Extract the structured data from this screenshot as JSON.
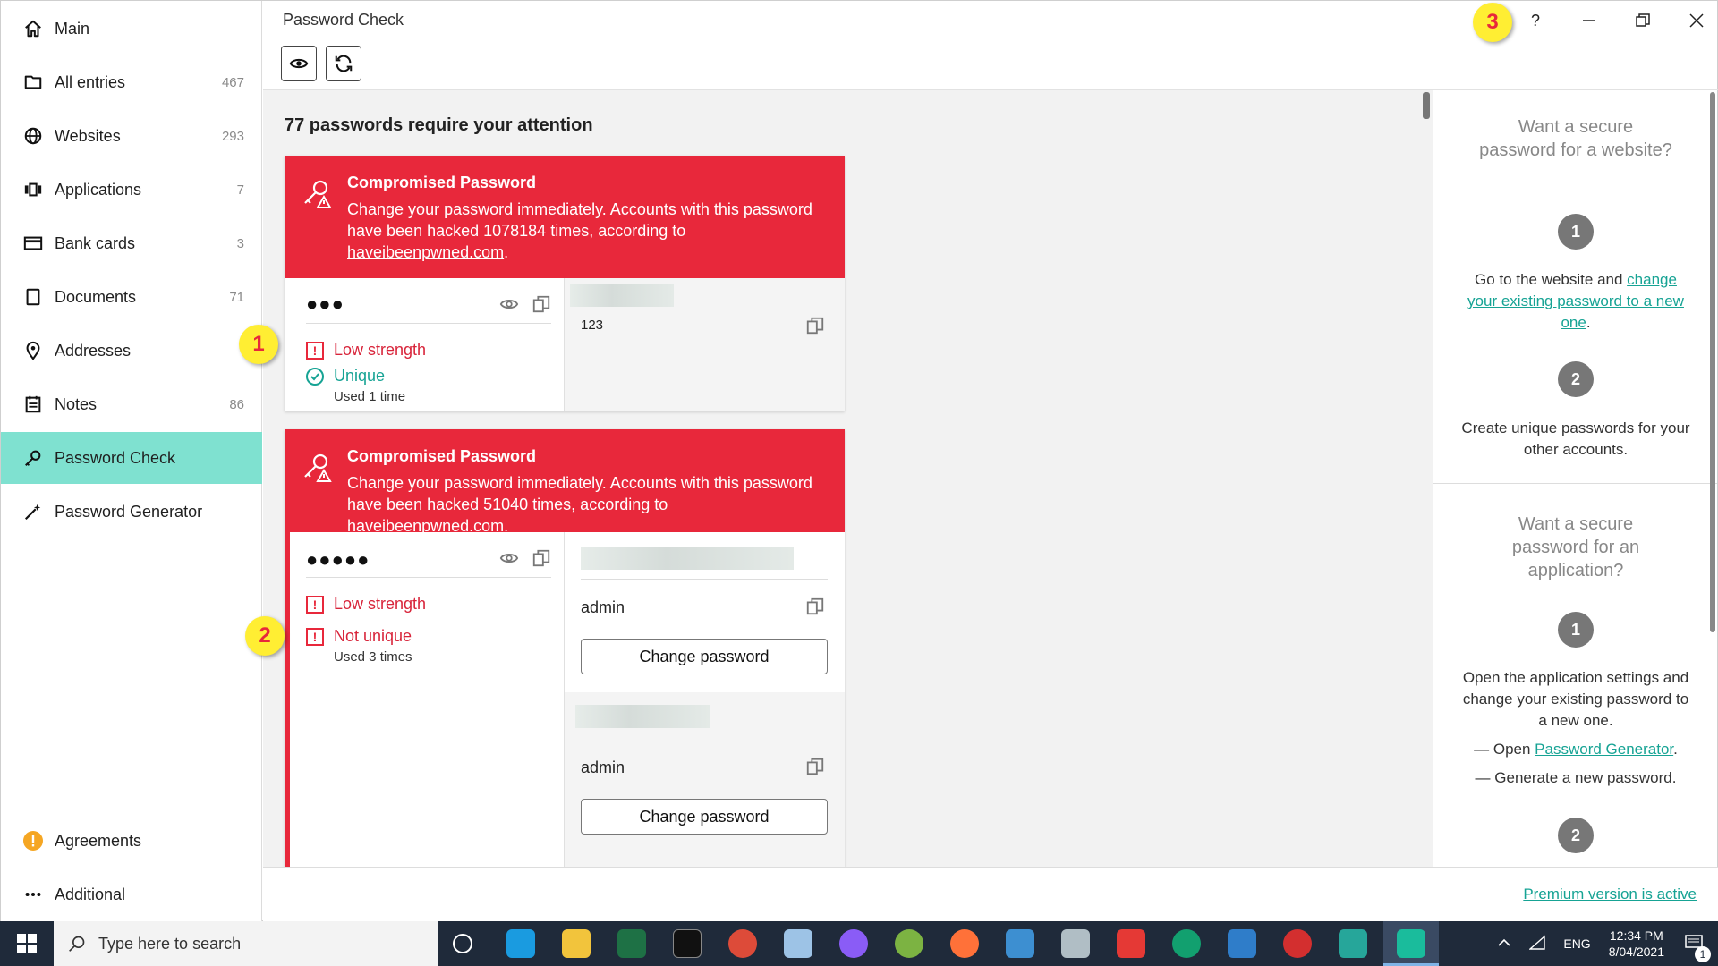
{
  "sidebar": {
    "items": [
      {
        "label": "Main",
        "count": "",
        "icon": "home-icon"
      },
      {
        "label": "All entries",
        "count": "467",
        "icon": "folder-icon"
      },
      {
        "label": "Websites",
        "count": "293",
        "icon": "globe-icon"
      },
      {
        "label": "Applications",
        "count": "7",
        "icon": "applications-icon"
      },
      {
        "label": "Bank cards",
        "count": "3",
        "icon": "card-icon"
      },
      {
        "label": "Documents",
        "count": "71",
        "icon": "document-icon"
      },
      {
        "label": "Addresses",
        "count": "",
        "icon": "pin-icon"
      },
      {
        "label": "Notes",
        "count": "86",
        "icon": "notes-icon"
      },
      {
        "label": "Password Check",
        "count": "",
        "icon": "key-icon"
      },
      {
        "label": "Password Generator",
        "count": "",
        "icon": "wand-icon"
      }
    ],
    "bottom": [
      {
        "label": "Agreements",
        "icon": "warning-icon"
      },
      {
        "label": "Additional",
        "icon": "more-icon"
      }
    ]
  },
  "window": {
    "title": "Password Check",
    "help": "?",
    "accent": "#7fe1d0",
    "danger": "#e8283b"
  },
  "main": {
    "heading": "77 passwords require your attention",
    "cards": [
      {
        "title": "Compromised Password",
        "body_prefix": "Change your password immediately. Accounts with this password have been hacked 1078184 times, according to ",
        "link": "haveibeenpwned.com",
        "body_suffix": ".",
        "masked": "●●●",
        "status1": "Low strength",
        "status2": "Unique",
        "used": "Used 1 time",
        "accounts": [
          {
            "name": "123"
          }
        ]
      },
      {
        "title": "Compromised Password",
        "body_prefix": "Change your password immediately. Accounts with this password have been hacked 51040 times, according to ",
        "link": "haveibeenpwned.com",
        "body_suffix": ".",
        "masked": "●●●●●",
        "status1": "Low strength",
        "status2": "Not unique",
        "used": "Used 3 times",
        "accounts": [
          {
            "name": "admin",
            "button": "Change password"
          },
          {
            "name": "admin",
            "button": "Change password"
          }
        ]
      }
    ]
  },
  "help": {
    "website": {
      "question": "Want a secure password for a website?",
      "step1_num": "1",
      "step1_prefix": "Go to the website and ",
      "step1_link": "change your existing password to a new one",
      "step1_suffix": ".",
      "step2_num": "2",
      "step2": "Create unique passwords for your other accounts."
    },
    "application": {
      "question": "Want a secure password for an application?",
      "step1_num": "1",
      "step1": "Open the application settings and change your existing password to a new one.",
      "bullet1_prefix": "— Open ",
      "bullet1_link": "Password Generator",
      "bullet1_suffix": ".",
      "bullet2": "— Generate a new password.",
      "step2_num": "2"
    }
  },
  "footer": {
    "premium": "Premium version is active"
  },
  "callouts": [
    "1",
    "2",
    "3"
  ],
  "taskbar": {
    "search_placeholder": "Type here to search",
    "lang": "ENG",
    "time": "12:34 PM",
    "date": "8/04/2021",
    "notifications": "1"
  }
}
